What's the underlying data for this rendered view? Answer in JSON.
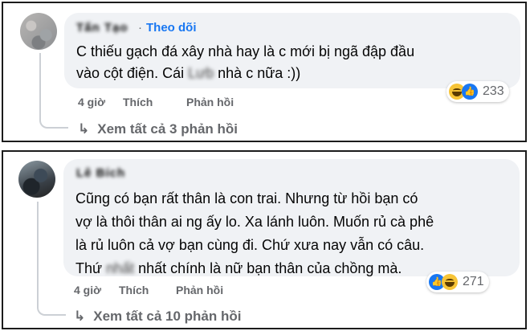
{
  "comments": [
    {
      "author": "Tấn Tạo",
      "separator": "·",
      "follow_label": "Theo dõi",
      "text_line1": "C thiếu gạch đá xây nhà hay là c mới bị ngã đập đầu",
      "text_line2_a": "vào cột điện. Cái ",
      "text_line2_blur": "Lưb",
      "text_line2_b": " nhà c nữa :))",
      "time": "4 giờ",
      "like_label": "Thích",
      "reply_label": "Phản hồi",
      "reaction_count": "233",
      "reactions": [
        "haha-icon",
        "like-icon"
      ],
      "view_replies": "Xem tất cả 3 phản hồi"
    },
    {
      "author": "Lê Bích",
      "text_line1": "Cũng có bạn rất thân là con trai. Nhưng từ hồi bạn có",
      "text_line2": "vợ là thôi thân ai ng ấy lo. Xa lánh luôn. Muốn rủ cà phê",
      "text_line3": "là rủ luôn cả vợ bạn cùng đi. Chứ xưa nay vẫn có câu.",
      "text_line4_a": "Thứ ",
      "text_line4_blur": "nhất",
      "text_line4_b": " nhất chính là nữ bạn thân của chồng mà.",
      "time": "4 giờ",
      "like_label": "Thích",
      "reply_label": "Phản hồi",
      "reaction_count": "271",
      "reactions": [
        "like-icon",
        "haha-icon"
      ],
      "view_replies": "Xem tất cả 10 phản hồi"
    }
  ],
  "colors": {
    "bubble": "#f0f2f5",
    "link_blue": "#1877f2",
    "meta_gray": "#65676b",
    "border": "#1c1c1c"
  }
}
